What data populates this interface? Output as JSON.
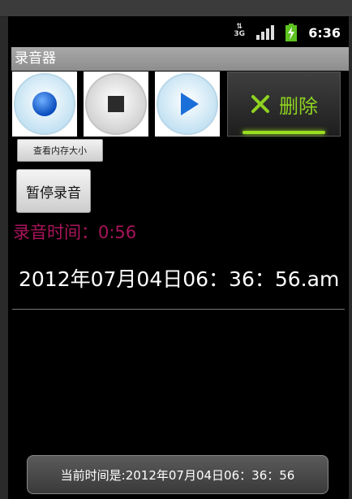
{
  "status_bar": {
    "network_label": "3G",
    "time": "6:36",
    "icons": [
      "data-3g-icon",
      "signal-icon",
      "battery-charging-icon"
    ]
  },
  "app": {
    "title": "录音器"
  },
  "controls": {
    "record_icon": "record-icon",
    "stop_icon": "stop-icon",
    "play_icon": "play-icon",
    "delete_label": "删除",
    "view_memory_label": "查看内存大小",
    "pause_record_label": "暂停录音"
  },
  "recording": {
    "time_text": "录音时间：0:56"
  },
  "datetime_text": "2012年07月04日06：36：56.am",
  "toast": {
    "text": "当前时间是:2012年07月04日06：36：56"
  },
  "colors": {
    "record_time": "#a8145a",
    "delete_accent": "#8fd320",
    "record_blue": "#1a64d6",
    "play_blue": "#1b6fd8",
    "title_bar": "#9a9a9a"
  }
}
